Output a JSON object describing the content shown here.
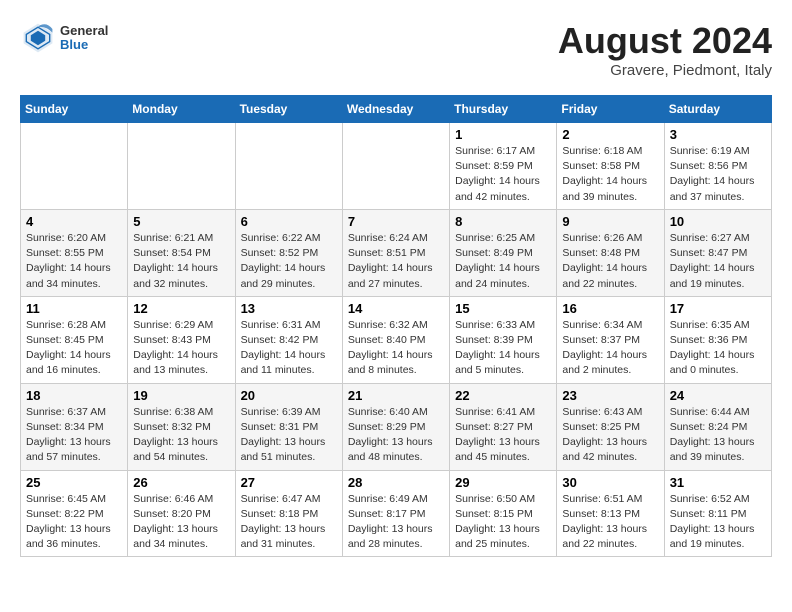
{
  "header": {
    "logo_general": "General",
    "logo_blue": "Blue",
    "title": "August 2024",
    "subtitle": "Gravere, Piedmont, Italy"
  },
  "weekdays": [
    "Sunday",
    "Monday",
    "Tuesday",
    "Wednesday",
    "Thursday",
    "Friday",
    "Saturday"
  ],
  "weeks": [
    [
      {
        "day": "",
        "info": ""
      },
      {
        "day": "",
        "info": ""
      },
      {
        "day": "",
        "info": ""
      },
      {
        "day": "",
        "info": ""
      },
      {
        "day": "1",
        "info": "Sunrise: 6:17 AM\nSunset: 8:59 PM\nDaylight: 14 hours\nand 42 minutes."
      },
      {
        "day": "2",
        "info": "Sunrise: 6:18 AM\nSunset: 8:58 PM\nDaylight: 14 hours\nand 39 minutes."
      },
      {
        "day": "3",
        "info": "Sunrise: 6:19 AM\nSunset: 8:56 PM\nDaylight: 14 hours\nand 37 minutes."
      }
    ],
    [
      {
        "day": "4",
        "info": "Sunrise: 6:20 AM\nSunset: 8:55 PM\nDaylight: 14 hours\nand 34 minutes."
      },
      {
        "day": "5",
        "info": "Sunrise: 6:21 AM\nSunset: 8:54 PM\nDaylight: 14 hours\nand 32 minutes."
      },
      {
        "day": "6",
        "info": "Sunrise: 6:22 AM\nSunset: 8:52 PM\nDaylight: 14 hours\nand 29 minutes."
      },
      {
        "day": "7",
        "info": "Sunrise: 6:24 AM\nSunset: 8:51 PM\nDaylight: 14 hours\nand 27 minutes."
      },
      {
        "day": "8",
        "info": "Sunrise: 6:25 AM\nSunset: 8:49 PM\nDaylight: 14 hours\nand 24 minutes."
      },
      {
        "day": "9",
        "info": "Sunrise: 6:26 AM\nSunset: 8:48 PM\nDaylight: 14 hours\nand 22 minutes."
      },
      {
        "day": "10",
        "info": "Sunrise: 6:27 AM\nSunset: 8:47 PM\nDaylight: 14 hours\nand 19 minutes."
      }
    ],
    [
      {
        "day": "11",
        "info": "Sunrise: 6:28 AM\nSunset: 8:45 PM\nDaylight: 14 hours\nand 16 minutes."
      },
      {
        "day": "12",
        "info": "Sunrise: 6:29 AM\nSunset: 8:43 PM\nDaylight: 14 hours\nand 13 minutes."
      },
      {
        "day": "13",
        "info": "Sunrise: 6:31 AM\nSunset: 8:42 PM\nDaylight: 14 hours\nand 11 minutes."
      },
      {
        "day": "14",
        "info": "Sunrise: 6:32 AM\nSunset: 8:40 PM\nDaylight: 14 hours\nand 8 minutes."
      },
      {
        "day": "15",
        "info": "Sunrise: 6:33 AM\nSunset: 8:39 PM\nDaylight: 14 hours\nand 5 minutes."
      },
      {
        "day": "16",
        "info": "Sunrise: 6:34 AM\nSunset: 8:37 PM\nDaylight: 14 hours\nand 2 minutes."
      },
      {
        "day": "17",
        "info": "Sunrise: 6:35 AM\nSunset: 8:36 PM\nDaylight: 14 hours\nand 0 minutes."
      }
    ],
    [
      {
        "day": "18",
        "info": "Sunrise: 6:37 AM\nSunset: 8:34 PM\nDaylight: 13 hours\nand 57 minutes."
      },
      {
        "day": "19",
        "info": "Sunrise: 6:38 AM\nSunset: 8:32 PM\nDaylight: 13 hours\nand 54 minutes."
      },
      {
        "day": "20",
        "info": "Sunrise: 6:39 AM\nSunset: 8:31 PM\nDaylight: 13 hours\nand 51 minutes."
      },
      {
        "day": "21",
        "info": "Sunrise: 6:40 AM\nSunset: 8:29 PM\nDaylight: 13 hours\nand 48 minutes."
      },
      {
        "day": "22",
        "info": "Sunrise: 6:41 AM\nSunset: 8:27 PM\nDaylight: 13 hours\nand 45 minutes."
      },
      {
        "day": "23",
        "info": "Sunrise: 6:43 AM\nSunset: 8:25 PM\nDaylight: 13 hours\nand 42 minutes."
      },
      {
        "day": "24",
        "info": "Sunrise: 6:44 AM\nSunset: 8:24 PM\nDaylight: 13 hours\nand 39 minutes."
      }
    ],
    [
      {
        "day": "25",
        "info": "Sunrise: 6:45 AM\nSunset: 8:22 PM\nDaylight: 13 hours\nand 36 minutes."
      },
      {
        "day": "26",
        "info": "Sunrise: 6:46 AM\nSunset: 8:20 PM\nDaylight: 13 hours\nand 34 minutes."
      },
      {
        "day": "27",
        "info": "Sunrise: 6:47 AM\nSunset: 8:18 PM\nDaylight: 13 hours\nand 31 minutes."
      },
      {
        "day": "28",
        "info": "Sunrise: 6:49 AM\nSunset: 8:17 PM\nDaylight: 13 hours\nand 28 minutes."
      },
      {
        "day": "29",
        "info": "Sunrise: 6:50 AM\nSunset: 8:15 PM\nDaylight: 13 hours\nand 25 minutes."
      },
      {
        "day": "30",
        "info": "Sunrise: 6:51 AM\nSunset: 8:13 PM\nDaylight: 13 hours\nand 22 minutes."
      },
      {
        "day": "31",
        "info": "Sunrise: 6:52 AM\nSunset: 8:11 PM\nDaylight: 13 hours\nand 19 minutes."
      }
    ]
  ]
}
